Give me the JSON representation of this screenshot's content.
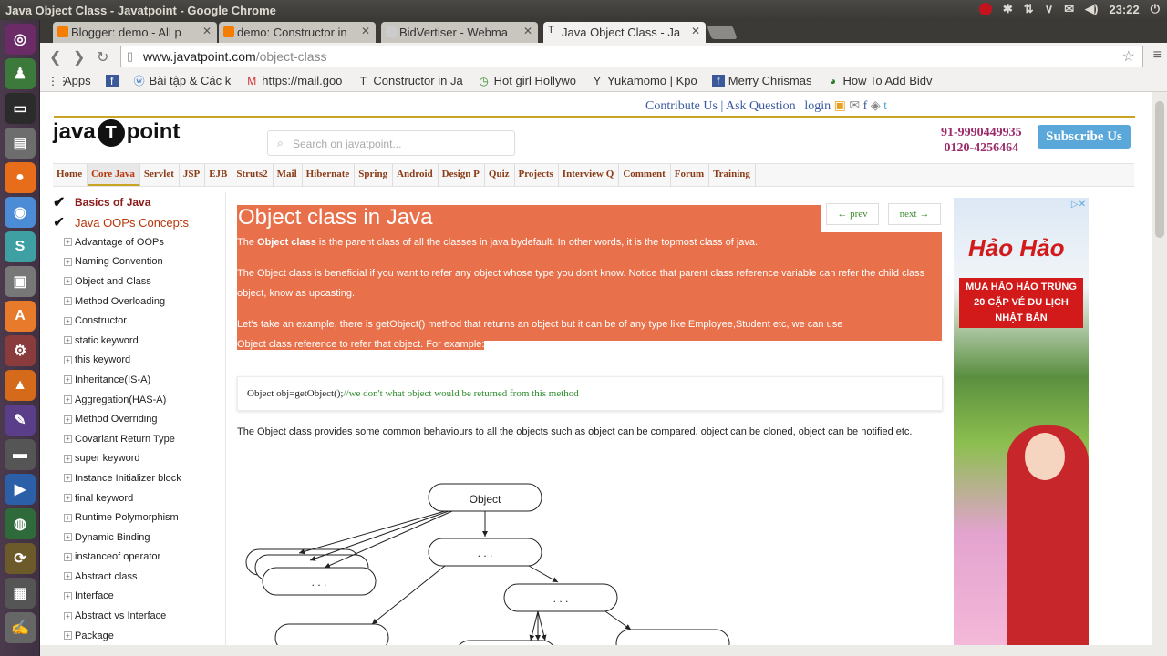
{
  "window": {
    "title": "Java Object Class - Javatpoint - Google Chrome",
    "clock": "23:22"
  },
  "tabs": [
    {
      "label": "Blogger: demo - All p"
    },
    {
      "label": "demo: Constructor in"
    },
    {
      "label": "BidVertiser - Webma"
    },
    {
      "label": "Java Object Class - Ja"
    }
  ],
  "address": {
    "host": "www.javatpoint.com",
    "path": "/object-class"
  },
  "bookmarks": [
    {
      "icon": "apps-icon",
      "label": "Apps"
    },
    {
      "icon": "facebook-icon",
      "label": ""
    },
    {
      "icon": "w-icon",
      "label": "Bài tập & Các k"
    },
    {
      "icon": "gmail-icon",
      "label": "https://mail.goo"
    },
    {
      "icon": "t-icon",
      "label": "Constructor in Ja"
    },
    {
      "icon": "clock-icon",
      "label": "Hot girl Hollywo"
    },
    {
      "icon": "y-icon",
      "label": "Yukamomo | Kpo"
    },
    {
      "icon": "facebook-icon",
      "label": "Merry Chrismas"
    },
    {
      "icon": "q-icon",
      "label": "How To Add Bidv"
    }
  ],
  "site": {
    "top_links": "Contribute Us | Ask Question | login",
    "logo_left": "java",
    "logo_mid": "T",
    "logo_right": "point",
    "search_placeholder": "Search on javatpoint...",
    "phone1": "91-9990449935",
    "phone2": "0120-4256464",
    "subscribe": "Subscribe Us",
    "menu": [
      "Home",
      "Core Java",
      "Servlet",
      "JSP",
      "EJB",
      "Struts2",
      "Mail",
      "Hibernate",
      "Spring",
      "Android",
      "Design P",
      "Quiz",
      "Projects",
      "Interview Q",
      "Comment",
      "Forum",
      "Training"
    ]
  },
  "sidebar": {
    "heading1": "Basics of Java",
    "heading2": "Java OOPs Concepts",
    "items": [
      "Advantage of OOPs",
      "Naming Convention",
      "Object and Class",
      "Method Overloading",
      "Constructor",
      "static keyword",
      "this keyword",
      "Inheritance(IS-A)",
      "Aggregation(HAS-A)",
      "Method Overriding",
      "Covariant Return Type",
      "super keyword",
      "Instance Initializer block",
      "final keyword",
      "Runtime Polymorphism",
      "Dynamic Binding",
      "instanceof operator",
      "Abstract class",
      "Interface",
      "Abstract vs Interface",
      "Package"
    ]
  },
  "content": {
    "title": "Object class in Java",
    "prev": "← prev",
    "next": "next →",
    "p1_pre": "The ",
    "p1_bold": "Object class",
    "p1_post": " is the parent class of all the classes in java bydefault. In other words, it is the topmost class of java.",
    "p2": "The Object class is beneficial if you want to refer any object whose type you don't know. Notice that parent class reference variable can refer the child class object, know as upcasting.",
    "p3a": "Let's take an example, there is getObject() method that returns an object but it can be of any type like Employee,Student etc, we can use",
    "p3b": "Object class reference to refer that object. For example:",
    "code": "Object obj=getObject();",
    "code_comment": "//we don't what object would be returned from this method",
    "p4": "The Object class provides some common behaviours to all the objects such as object can be compared, object can be cloned, object can be notified etc.",
    "diagram_root": "Object",
    "diagram_dots": ". . ."
  },
  "ad": {
    "brand": "Hảo Hảo",
    "promo": "MUA HẢO HẢO TRÚNG 20 CẶP VÉ DU LỊCH NHẬT BẢN"
  }
}
